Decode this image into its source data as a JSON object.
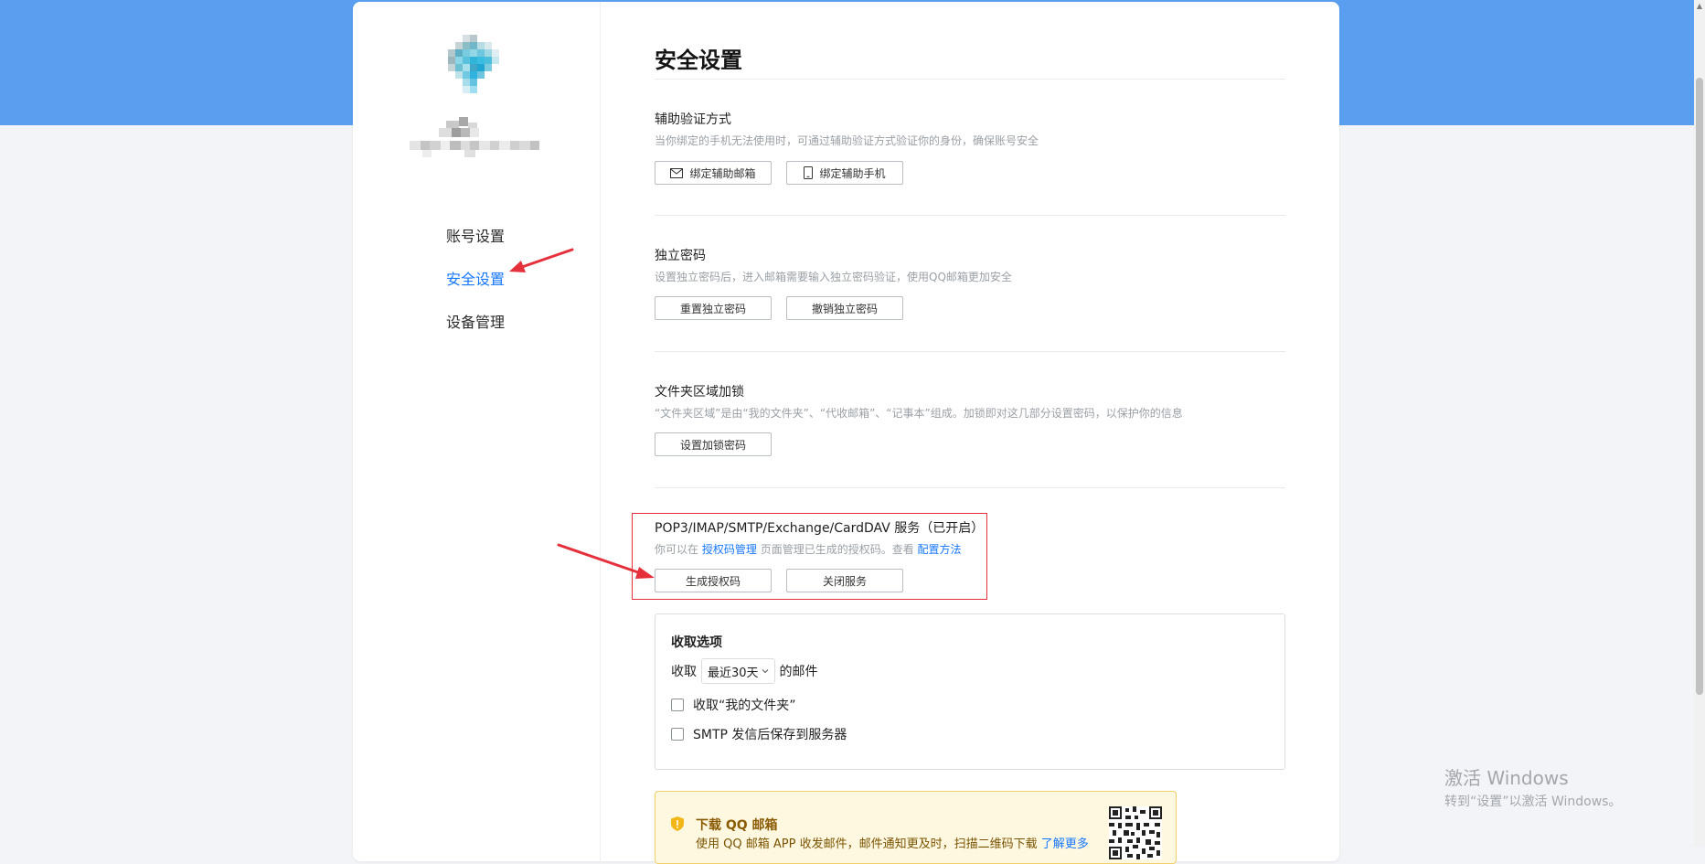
{
  "sidebar": {
    "items": [
      {
        "label": "账号设置",
        "active": false
      },
      {
        "label": "安全设置",
        "active": true
      },
      {
        "label": "设备管理",
        "active": false
      }
    ]
  },
  "main": {
    "title": "安全设置",
    "aux_verify": {
      "title": "辅助验证方式",
      "desc": "当你绑定的手机无法使用时，可通过辅助验证方式验证你的身份，确保账号安全",
      "btn_email": "绑定辅助邮箱",
      "btn_phone": "绑定辅助手机"
    },
    "independent_pwd": {
      "title": "独立密码",
      "desc": "设置独立密码后，进入邮箱需要输入独立密码验证，使用QQ邮箱更加安全",
      "btn_reset": "重置独立密码",
      "btn_revoke": "撤销独立密码"
    },
    "folder_lock": {
      "title": "文件夹区域加锁",
      "desc": "“文件夹区域”是由“我的文件夹”、“代收邮箱”、“记事本”组成。加锁即对这几部分设置密码，以保护你的信息",
      "btn_set": "设置加锁密码"
    },
    "pop3": {
      "title": "POP3/IMAP/SMTP/Exchange/CardDAV 服务（已开启）",
      "desc_prefix": "你可以在",
      "desc_link1": "授权码管理",
      "desc_middle": "页面管理已生成的授权码。查看",
      "desc_link2": "配置方法",
      "btn_generate": "生成授权码",
      "btn_close": "关闭服务"
    },
    "options": {
      "title": "收取选项",
      "receive_prefix": "收取",
      "receive_select": "最近30天",
      "receive_suffix": "的邮件",
      "checkbox1": "收取“我的文件夹”",
      "checkbox1_checked": false,
      "checkbox2": "SMTP 发信后保存到服务器",
      "checkbox2_checked": false
    },
    "banner": {
      "title": "下载 QQ 邮箱",
      "text": "使用 QQ 邮箱 APP 收发邮件，邮件通知更及时，扫描二维码下载",
      "link": "了解更多"
    }
  },
  "watermark": {
    "line1": "激活 Windows",
    "line2": "转到“设置”以激活 Windows。"
  },
  "colors": {
    "accent": "#1677ff",
    "header_band": "#5a9ef0",
    "annotation_red": "#e5303c"
  },
  "icons": {
    "email": "envelope-icon",
    "phone": "mobile-icon",
    "warning": "warning-shield-icon",
    "select": "chevron-down-icon"
  }
}
